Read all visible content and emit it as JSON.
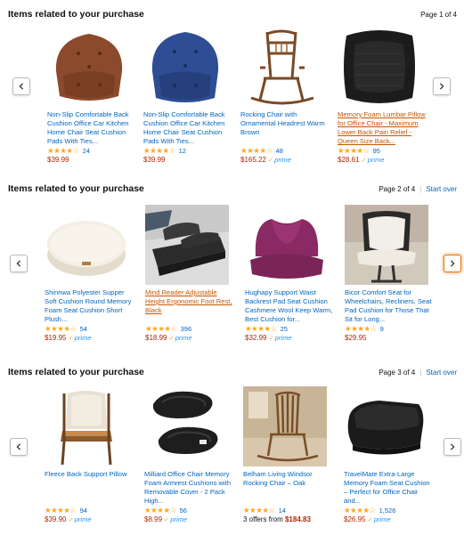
{
  "sections": [
    {
      "title": "Items related to your purchase",
      "page": "Page 1 of 4",
      "start_over": "",
      "products": [
        {
          "title": "Non-Slip Comfortable Back Cushion Office Car Kitchen Home Chair Seat Cushion Pads With Ties...",
          "stars": "★★★★☆",
          "rating": 3.5,
          "count": "24",
          "price": "$39.99",
          "prime": "",
          "offers": "",
          "offers_price": "",
          "highlight": false,
          "image": "brown-cushion"
        },
        {
          "title": "Non-Slip Comfortable Back Cushion Office Car Kitchen Home Chair Seat Cushion Pads With Ties...",
          "stars": "★★★★☆",
          "rating": 3.5,
          "count": "12",
          "price": "$39.99",
          "prime": "",
          "offers": "",
          "offers_price": "",
          "highlight": false,
          "image": "blue-cushion"
        },
        {
          "title": "Rocking Chair with Ornamental Headrest Warm Brown",
          "stars": "★★★★☆",
          "rating": 4,
          "count": "48",
          "price": "$165.22",
          "prime": "prime",
          "offers": "",
          "offers_price": "",
          "highlight": false,
          "image": "rocking-chair"
        },
        {
          "title": "Memory Foam Lumbar Pillow for Office Chair - Maximum Lower Back Pain Relief - Queen Size Back...",
          "stars": "★★★★☆",
          "rating": 4,
          "count": "95",
          "price": "$28.61",
          "prime": "prime",
          "offers": "",
          "offers_price": "",
          "highlight": true,
          "image": "lumbar-pillow"
        }
      ]
    },
    {
      "title": "Items related to your purchase",
      "page": "Page 2 of 4",
      "start_over": "Start over",
      "products": [
        {
          "title": "Shinnwa Polyester Supper Soft Cushion Round Memory Foam Seat Cushion Short Plush...",
          "stars": "★★★★☆",
          "rating": 4,
          "count": "54",
          "price": "$19.95",
          "prime": "prime",
          "offers": "",
          "offers_price": "",
          "highlight": false,
          "image": "round-cushion"
        },
        {
          "title": "Mind Reader Adjustable Height Ergonomic Foot Rest, Black",
          "stars": "★★★★☆",
          "rating": 4,
          "count": "396",
          "price": "$18.99",
          "prime": "prime",
          "offers": "",
          "offers_price": "",
          "highlight": true,
          "image": "foot-rest"
        },
        {
          "title": "Hughapy Support Waist Backrest Pad Seat Cushion Cashmere Wool Keep Warm, Best Cushion for...",
          "stars": "★★★★☆",
          "rating": 4,
          "count": "25",
          "price": "$32.99",
          "prime": "prime",
          "offers": "",
          "offers_price": "",
          "highlight": false,
          "image": "purple-cushion"
        },
        {
          "title": "Bicor Comfort Seat for Wheelchairs, Recliners, Seat Pad Cushion for Those That Sit for Long...",
          "stars": "★★★★☆",
          "rating": 3.5,
          "count": "9",
          "price": "$29.95",
          "prime": "",
          "offers": "",
          "offers_price": "",
          "highlight": false,
          "image": "office-chair-cushion"
        }
      ]
    },
    {
      "title": "Items related to your purchase",
      "page": "Page 3 of 4",
      "start_over": "Start over",
      "products": [
        {
          "title": "Fleece Back Support Pillow",
          "stars": "★★★★☆",
          "rating": 3.5,
          "count": "94",
          "price": "$39.90",
          "prime": "prime",
          "offers": "",
          "offers_price": "",
          "highlight": false,
          "image": "fleece-pillow"
        },
        {
          "title": "Milliard Office Chair Memory Foam Armrest Cushions with Removable Cover - 2 Pack High...",
          "stars": "★★★★☆",
          "rating": 4.5,
          "count": "56",
          "price": "$8.99",
          "prime": "prime",
          "offers": "",
          "offers_price": "",
          "highlight": false,
          "image": "armrest-pads"
        },
        {
          "title": "Belham Living Windsor Rocking Chair – Oak",
          "stars": "★★★★☆",
          "rating": 4,
          "count": "14",
          "price": "",
          "prime": "",
          "offers": "3 offers from ",
          "offers_price": "$184.83",
          "highlight": false,
          "image": "windsor-rocker"
        },
        {
          "title": "TravelMate Extra-Large Memory Foam Seat Cushion – Perfect for Office Chair and...",
          "stars": "★★★★☆",
          "rating": 4,
          "count": "1,526",
          "price": "$26.95",
          "prime": "prime",
          "offers": "",
          "offers_price": "",
          "highlight": false,
          "image": "black-seat-cushion"
        }
      ]
    }
  ]
}
